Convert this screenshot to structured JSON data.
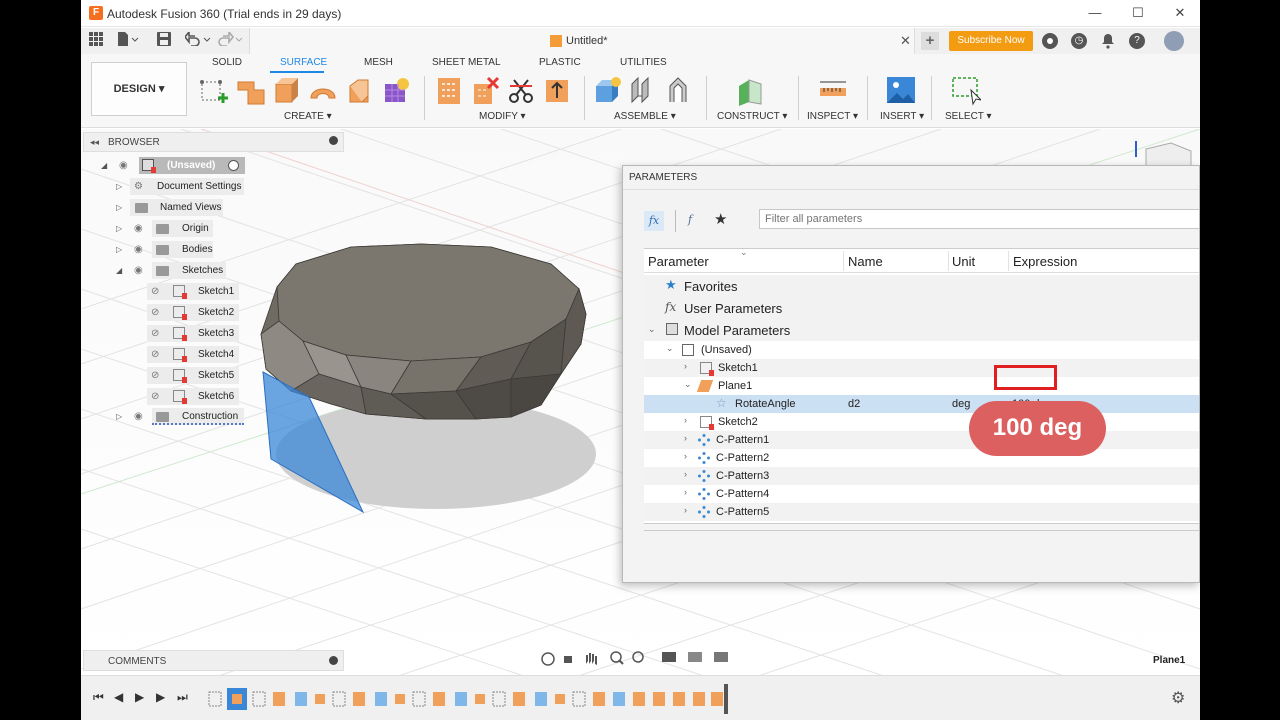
{
  "window": {
    "title": "Autodesk Fusion 360 (Trial ends in 29 days)",
    "app_icon": "F",
    "controls": {
      "minimize": "—",
      "maximize": "☐",
      "close": "✕"
    }
  },
  "tabbar": {
    "doc_name": "Untitled*",
    "close": "✕",
    "new_tab": "+",
    "subscribe_label": "Subscribe Now",
    "icons": [
      "grid-icon",
      "file-icon",
      "save-icon",
      "undo-icon",
      "redo-icon",
      "job-status-icon",
      "clock-icon",
      "bell-icon",
      "help-icon",
      "avatar"
    ],
    "help_glyph": "?",
    "bell_glyph": "♪",
    "clock_glyph": "◷"
  },
  "toolbar": {
    "workspace": "DESIGN ▾",
    "tabs": [
      "SOLID",
      "SURFACE",
      "MESH",
      "SHEET METAL",
      "PLASTIC",
      "UTILITIES"
    ],
    "active_tab": "SURFACE",
    "groups": [
      "CREATE ▾",
      "MODIFY ▾",
      "ASSEMBLE ▾",
      "CONSTRUCT ▾",
      "INSPECT ▾",
      "INSERT ▾",
      "SELECT ▾"
    ]
  },
  "browser": {
    "title": "BROWSER",
    "collapse": "◂◂",
    "root": "(Unsaved)",
    "items": [
      {
        "label": "Document Settings",
        "icon": "gear-icon"
      },
      {
        "label": "Named Views",
        "icon": "folder-icon"
      },
      {
        "label": "Origin",
        "icon": "folder-icon"
      },
      {
        "label": "Bodies",
        "icon": "folder-icon"
      },
      {
        "label": "Sketches",
        "icon": "folder-icon"
      }
    ],
    "sketches": [
      "Sketch1",
      "Sketch2",
      "Sketch3",
      "Sketch4",
      "Sketch5",
      "Sketch6"
    ],
    "construction": "Construction"
  },
  "comments": {
    "title": "COMMENTS"
  },
  "viewport": {
    "selected_label": "Plane1"
  },
  "parameters": {
    "title": "PARAMETERS",
    "filter_placeholder": "Filter all parameters",
    "columns": [
      "Parameter",
      "Name",
      "Unit",
      "Expression"
    ],
    "favorites": "Favorites",
    "user_parameters": "User Parameters",
    "model_parameters": "Model Parameters",
    "unsaved": "(Unsaved)",
    "features": [
      "Sketch1",
      "Plane1"
    ],
    "selected": {
      "parameter": "RotateAngle",
      "name": "d2",
      "unit": "deg",
      "expression": "100 deg"
    },
    "after": [
      "Sketch2",
      "C-Pattern1",
      "C-Pattern2",
      "C-Pattern3",
      "C-Pattern4",
      "C-Pattern5"
    ],
    "callout": "100 deg"
  },
  "colors": {
    "accent": "#1e88e5",
    "subscribe": "#f39c12",
    "highlight": "#e02020",
    "callout": "#dc6060",
    "selection": "#cce0f3",
    "body": "#6f6a62",
    "plane": "#3a87d8"
  }
}
